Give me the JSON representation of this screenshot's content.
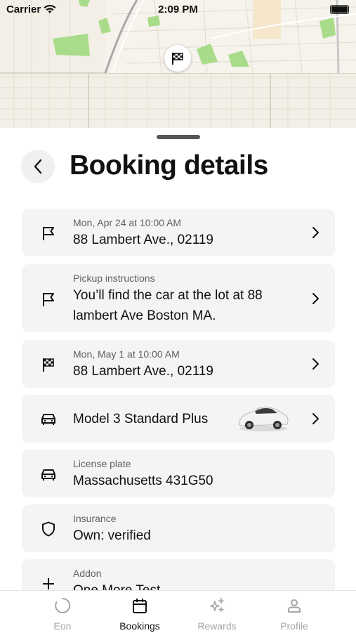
{
  "status_bar": {
    "carrier": "Carrier",
    "time": "2:09 PM"
  },
  "map": {
    "pin_icon": "checkered-flag-icon"
  },
  "header": {
    "title": "Booking details",
    "back_icon": "chevron-left-icon"
  },
  "cards": [
    {
      "icon": "flag-icon",
      "sub": "Mon, Apr 24 at 10:00 AM",
      "main": "88 Lambert Ave., 02119",
      "chevron": true
    },
    {
      "icon": "flag-icon",
      "sub": "Pickup instructions",
      "main": "You’ll find the car at the lot at 88 lambert Ave Boston MA.",
      "chevron": true
    },
    {
      "icon": "checkered-flag-icon",
      "sub": "Mon, May 1 at 10:00 AM",
      "main": "88 Lambert Ave., 02119",
      "chevron": true
    },
    {
      "icon": "car-icon",
      "main": "Model 3 Standard Plus",
      "image": "car-thumbnail",
      "chevron": true
    },
    {
      "icon": "car-icon",
      "sub": "License plate",
      "main": "Massachusetts 431G50"
    },
    {
      "icon": "shield-icon",
      "sub": "Insurance",
      "main": "Own: verified"
    },
    {
      "icon": "plus-icon",
      "sub": "Addon",
      "main": "One More Test"
    }
  ],
  "tabs": [
    {
      "label": "Eon",
      "icon": "eon-icon",
      "active": false
    },
    {
      "label": "Bookings",
      "icon": "calendar-icon",
      "active": true
    },
    {
      "label": "Rewards",
      "icon": "sparkle-icon",
      "active": false
    },
    {
      "label": "Profile",
      "icon": "person-icon",
      "active": false
    }
  ],
  "colors": {
    "card_bg": "#f4f4f4",
    "inactive_tab": "#a5a5a5",
    "map_bg": "#f3efe6",
    "park_green": "#a9dc8a"
  }
}
